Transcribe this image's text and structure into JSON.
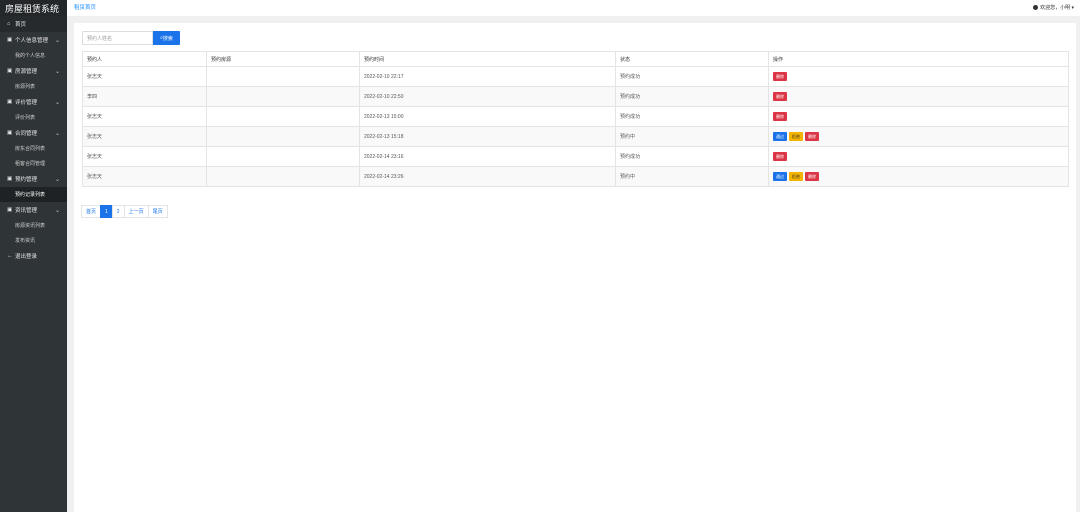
{
  "app": {
    "title": "房屋租赁系统"
  },
  "topbar": {
    "breadcrumb": "租赁首页",
    "user": "欢迎您，小明 ▾"
  },
  "sidebar": {
    "home": "首页",
    "groups": [
      {
        "label": "个人信息管理",
        "icon": "person-icon",
        "items": [
          "我的个人信息"
        ]
      },
      {
        "label": "房源管理",
        "icon": "house-icon",
        "items": [
          "房源列表"
        ]
      },
      {
        "label": "评价管理",
        "icon": "comment-icon",
        "items": [
          "评价列表"
        ]
      },
      {
        "label": "合同管理",
        "icon": "contract-icon",
        "items": [
          "房东合同列表",
          "租客合同管理"
        ]
      },
      {
        "label": "预约管理",
        "icon": "calendar-icon",
        "items": [
          "预约记录列表"
        ]
      },
      {
        "label": "资讯管理",
        "icon": "news-icon",
        "items": [
          "房源资讯列表",
          "发布资讯"
        ]
      }
    ],
    "logout": "退出登录"
  },
  "search": {
    "placeholder": "预约人姓名",
    "button": "搜索"
  },
  "table": {
    "headers": [
      "预约人",
      "预约房源",
      "预约时间",
      "状态",
      "操作"
    ],
    "rows": [
      {
        "name": "张志天",
        "house": "",
        "time": "2022-02-10 22:17",
        "status": "预约成功",
        "actions": [
          "删除"
        ]
      },
      {
        "name": "李四",
        "house": "",
        "time": "2022-02-10 22:50",
        "status": "预约成功",
        "actions": [
          "删除"
        ]
      },
      {
        "name": "张志天",
        "house": "",
        "time": "2022-02-13 15:00",
        "status": "预约成功",
        "actions": [
          "删除"
        ]
      },
      {
        "name": "张志天",
        "house": "",
        "time": "2022-02-13 15:18",
        "status": "预约中",
        "actions": [
          "通过",
          "拒绝",
          "删除"
        ]
      },
      {
        "name": "张志天",
        "house": "",
        "time": "2022-02-14 23:16",
        "status": "预约成功",
        "actions": [
          "删除"
        ]
      },
      {
        "name": "张志天",
        "house": "",
        "time": "2022-02-14 23:26",
        "status": "预约中",
        "actions": [
          "通过",
          "拒绝",
          "删除"
        ]
      }
    ]
  },
  "pager": {
    "first": "首页",
    "pages": [
      "1",
      "2"
    ],
    "current": "1",
    "next": "上一页",
    "last": "尾页"
  },
  "colors": {
    "sidebar": "#2f3437",
    "primary": "#1a73e8",
    "danger": "#dc3545",
    "warning": "#f5b400"
  }
}
